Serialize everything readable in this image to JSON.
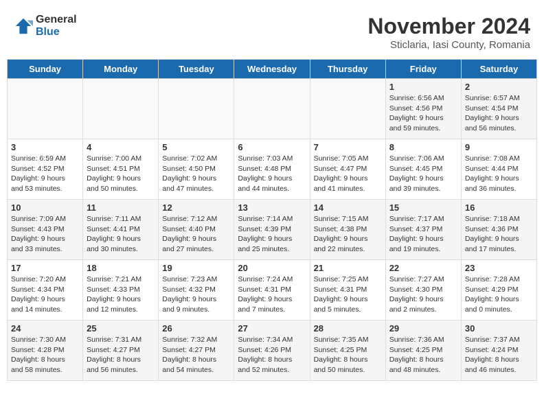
{
  "logo": {
    "general": "General",
    "blue": "Blue"
  },
  "title": "November 2024",
  "subtitle": "Sticlaria, Iasi County, Romania",
  "headers": [
    "Sunday",
    "Monday",
    "Tuesday",
    "Wednesday",
    "Thursday",
    "Friday",
    "Saturday"
  ],
  "weeks": [
    [
      {
        "day": "",
        "info": ""
      },
      {
        "day": "",
        "info": ""
      },
      {
        "day": "",
        "info": ""
      },
      {
        "day": "",
        "info": ""
      },
      {
        "day": "",
        "info": ""
      },
      {
        "day": "1",
        "info": "Sunrise: 6:56 AM\nSunset: 4:56 PM\nDaylight: 9 hours and 59 minutes."
      },
      {
        "day": "2",
        "info": "Sunrise: 6:57 AM\nSunset: 4:54 PM\nDaylight: 9 hours and 56 minutes."
      }
    ],
    [
      {
        "day": "3",
        "info": "Sunrise: 6:59 AM\nSunset: 4:52 PM\nDaylight: 9 hours and 53 minutes."
      },
      {
        "day": "4",
        "info": "Sunrise: 7:00 AM\nSunset: 4:51 PM\nDaylight: 9 hours and 50 minutes."
      },
      {
        "day": "5",
        "info": "Sunrise: 7:02 AM\nSunset: 4:50 PM\nDaylight: 9 hours and 47 minutes."
      },
      {
        "day": "6",
        "info": "Sunrise: 7:03 AM\nSunset: 4:48 PM\nDaylight: 9 hours and 44 minutes."
      },
      {
        "day": "7",
        "info": "Sunrise: 7:05 AM\nSunset: 4:47 PM\nDaylight: 9 hours and 41 minutes."
      },
      {
        "day": "8",
        "info": "Sunrise: 7:06 AM\nSunset: 4:45 PM\nDaylight: 9 hours and 39 minutes."
      },
      {
        "day": "9",
        "info": "Sunrise: 7:08 AM\nSunset: 4:44 PM\nDaylight: 9 hours and 36 minutes."
      }
    ],
    [
      {
        "day": "10",
        "info": "Sunrise: 7:09 AM\nSunset: 4:43 PM\nDaylight: 9 hours and 33 minutes."
      },
      {
        "day": "11",
        "info": "Sunrise: 7:11 AM\nSunset: 4:41 PM\nDaylight: 9 hours and 30 minutes."
      },
      {
        "day": "12",
        "info": "Sunrise: 7:12 AM\nSunset: 4:40 PM\nDaylight: 9 hours and 27 minutes."
      },
      {
        "day": "13",
        "info": "Sunrise: 7:14 AM\nSunset: 4:39 PM\nDaylight: 9 hours and 25 minutes."
      },
      {
        "day": "14",
        "info": "Sunrise: 7:15 AM\nSunset: 4:38 PM\nDaylight: 9 hours and 22 minutes."
      },
      {
        "day": "15",
        "info": "Sunrise: 7:17 AM\nSunset: 4:37 PM\nDaylight: 9 hours and 19 minutes."
      },
      {
        "day": "16",
        "info": "Sunrise: 7:18 AM\nSunset: 4:36 PM\nDaylight: 9 hours and 17 minutes."
      }
    ],
    [
      {
        "day": "17",
        "info": "Sunrise: 7:20 AM\nSunset: 4:34 PM\nDaylight: 9 hours and 14 minutes."
      },
      {
        "day": "18",
        "info": "Sunrise: 7:21 AM\nSunset: 4:33 PM\nDaylight: 9 hours and 12 minutes."
      },
      {
        "day": "19",
        "info": "Sunrise: 7:23 AM\nSunset: 4:32 PM\nDaylight: 9 hours and 9 minutes."
      },
      {
        "day": "20",
        "info": "Sunrise: 7:24 AM\nSunset: 4:31 PM\nDaylight: 9 hours and 7 minutes."
      },
      {
        "day": "21",
        "info": "Sunrise: 7:25 AM\nSunset: 4:31 PM\nDaylight: 9 hours and 5 minutes."
      },
      {
        "day": "22",
        "info": "Sunrise: 7:27 AM\nSunset: 4:30 PM\nDaylight: 9 hours and 2 minutes."
      },
      {
        "day": "23",
        "info": "Sunrise: 7:28 AM\nSunset: 4:29 PM\nDaylight: 9 hours and 0 minutes."
      }
    ],
    [
      {
        "day": "24",
        "info": "Sunrise: 7:30 AM\nSunset: 4:28 PM\nDaylight: 8 hours and 58 minutes."
      },
      {
        "day": "25",
        "info": "Sunrise: 7:31 AM\nSunset: 4:27 PM\nDaylight: 8 hours and 56 minutes."
      },
      {
        "day": "26",
        "info": "Sunrise: 7:32 AM\nSunset: 4:27 PM\nDaylight: 8 hours and 54 minutes."
      },
      {
        "day": "27",
        "info": "Sunrise: 7:34 AM\nSunset: 4:26 PM\nDaylight: 8 hours and 52 minutes."
      },
      {
        "day": "28",
        "info": "Sunrise: 7:35 AM\nSunset: 4:25 PM\nDaylight: 8 hours and 50 minutes."
      },
      {
        "day": "29",
        "info": "Sunrise: 7:36 AM\nSunset: 4:25 PM\nDaylight: 8 hours and 48 minutes."
      },
      {
        "day": "30",
        "info": "Sunrise: 7:37 AM\nSunset: 4:24 PM\nDaylight: 8 hours and 46 minutes."
      }
    ]
  ]
}
